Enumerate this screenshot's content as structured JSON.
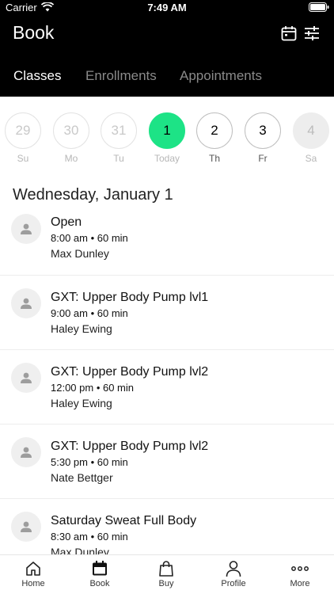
{
  "status_bar": {
    "carrier": "Carrier",
    "time": "7:49 AM"
  },
  "header": {
    "title": "Book",
    "icons": [
      "calendar-icon",
      "filter-sliders-icon"
    ]
  },
  "tabs": [
    {
      "label": "Classes",
      "active": true
    },
    {
      "label": "Enrollments",
      "active": false
    },
    {
      "label": "Appointments",
      "active": false
    }
  ],
  "days": [
    {
      "num": "29",
      "label": "Su"
    },
    {
      "num": "30",
      "label": "Mo"
    },
    {
      "num": "31",
      "label": "Tu"
    },
    {
      "num": "1",
      "label": "Today"
    },
    {
      "num": "2",
      "label": "Th"
    },
    {
      "num": "3",
      "label": "Fr"
    },
    {
      "num": "4",
      "label": "Sa"
    }
  ],
  "date_heading": "Wednesday, January 1",
  "classes": [
    {
      "name": "Open",
      "time": "8:00 am • 60 min",
      "instructor": "Max Dunley"
    },
    {
      "name": "GXT: Upper Body Pump lvl1",
      "time": "9:00 am • 60 min",
      "instructor": "Haley Ewing"
    },
    {
      "name": "GXT: Upper Body Pump lvl2",
      "time": "12:00 pm • 60 min",
      "instructor": "Haley Ewing"
    },
    {
      "name": "GXT: Upper Body Pump lvl2",
      "time": "5:30 pm • 60 min",
      "instructor": "Nate Bettger"
    },
    {
      "name": "Saturday Sweat Full Body",
      "time": "8:30 am • 60 min",
      "instructor": "Max Dunley"
    }
  ],
  "tabbar": [
    {
      "label": "Home",
      "icon": "home-icon"
    },
    {
      "label": "Book",
      "icon": "calendar-icon"
    },
    {
      "label": "Buy",
      "icon": "shopping-bag-icon"
    },
    {
      "label": "Profile",
      "icon": "person-icon"
    },
    {
      "label": "More",
      "icon": "more-dots-icon"
    }
  ],
  "colors": {
    "accent": "#1de386",
    "header_bg": "#000000"
  }
}
